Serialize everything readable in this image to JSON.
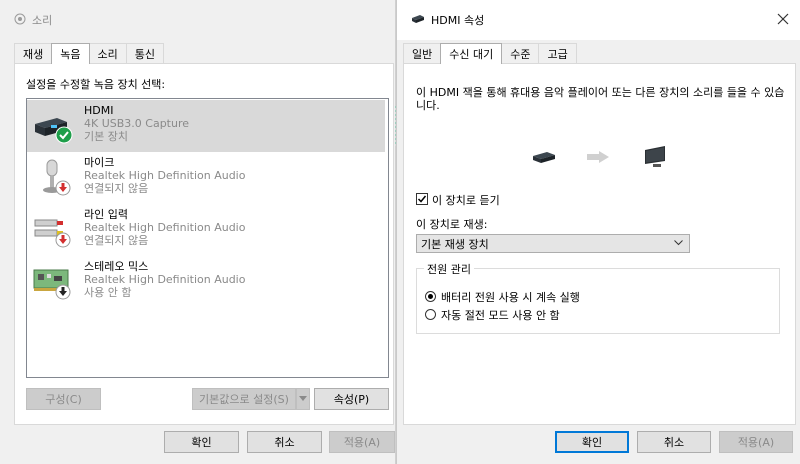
{
  "sound": {
    "title": "소리",
    "tabs": [
      "재생",
      "녹음",
      "소리",
      "통신"
    ],
    "active_tab": 1,
    "instruction": "설정을 수정할 녹음 장치 선택:",
    "devices": [
      {
        "name": "HDMI",
        "driver": "4K USB3.0 Capture",
        "status": "기본 장치",
        "selected": true
      },
      {
        "name": "마이크",
        "driver": "Realtek High Definition Audio",
        "status": "연결되지 않음"
      },
      {
        "name": "라인 입력",
        "driver": "Realtek High Definition Audio",
        "status": "연결되지 않음"
      },
      {
        "name": "스테레오 믹스",
        "driver": "Realtek High Definition Audio",
        "status": "사용 안 함"
      }
    ],
    "buttons": {
      "configure": "구성(C)",
      "set_default": "기본값으로 설정(S)",
      "properties": "속성(P)",
      "ok": "확인",
      "cancel": "취소",
      "apply": "적용(A)"
    }
  },
  "props": {
    "title": "HDMI 속성",
    "tabs": [
      "일반",
      "수신 대기",
      "수준",
      "고급"
    ],
    "active_tab": 1,
    "description": "이 HDMI 잭을 통해 휴대용 음악 플레이어 또는 다른 장치의 소리를 들을 수 있습니다.",
    "listen_checkbox": {
      "label": "이 장치로 듣기",
      "checked": true
    },
    "playback_label": "이 장치로 재생:",
    "playback_select": "기본 재생 장치",
    "power_group": {
      "title": "전원 관리",
      "options": [
        {
          "label": "배터리 전원 사용 시 계속 실행",
          "selected": true
        },
        {
          "label": "자동 절전 모드 사용 안 함",
          "selected": false
        }
      ]
    },
    "buttons": {
      "ok": "확인",
      "cancel": "취소",
      "apply": "적용(A)"
    }
  },
  "colors": {
    "accent": "#0078d7",
    "check_green": "#1e9e4a",
    "badge_red": "#d32f2f"
  }
}
